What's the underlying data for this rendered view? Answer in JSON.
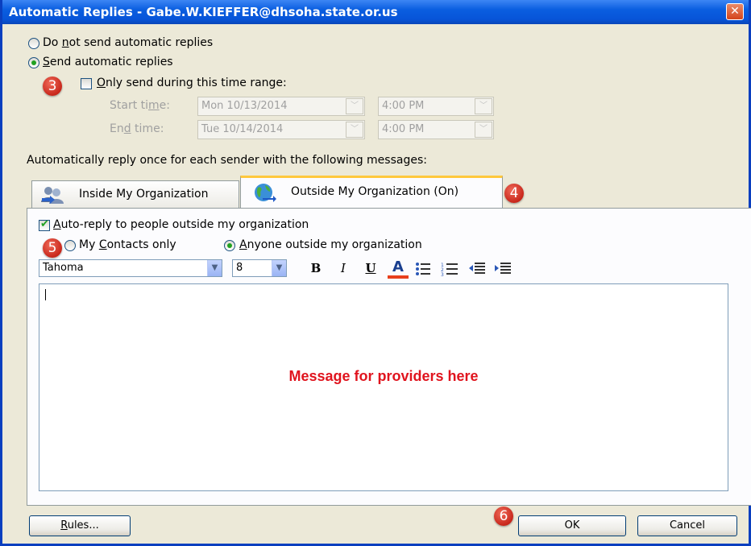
{
  "window": {
    "title": "Automatic Replies - Gabe.W.KIEFFER@dhsoha.state.or.us",
    "close_glyph": "✕"
  },
  "mode": {
    "do_not_send_prefix": "Do ",
    "do_not_send_u": "n",
    "do_not_send_rest": "ot send automatic replies",
    "send_u": "S",
    "send_rest": "end automatic replies",
    "selected": "send"
  },
  "time_range": {
    "only_send_u": "O",
    "only_send_rest": "nly send during this time range:",
    "checked": false,
    "start_label_pre": "Start ti",
    "start_label_u": "m",
    "start_label_post": "e:",
    "start_date": "Mon 10/13/2014",
    "start_time": "4:00 PM",
    "end_label_pre": "En",
    "end_label_u": "d",
    "end_label_post": " time:",
    "end_date": "Tue 10/14/2014",
    "end_time": "4:00 PM"
  },
  "reply_heading": "Automatically reply once for each sender with the following messages:",
  "tabs": [
    {
      "label": "Inside My Organization",
      "icon": "people-icon",
      "active": false
    },
    {
      "label": "Outside My Organization (On)",
      "icon": "globe-icon",
      "active": true
    }
  ],
  "outside": {
    "auto_reply_u": "A",
    "auto_reply_rest": "uto-reply to people outside my organization",
    "auto_reply_checked": true,
    "my_contacts_pre": "My ",
    "my_contacts_u": "C",
    "my_contacts_rest": "ontacts only",
    "anyone_u": "A",
    "anyone_rest": "nyone outside my organization",
    "audience_selected": "anyone"
  },
  "formatting": {
    "font": "Tahoma",
    "size": "8",
    "bold": "B",
    "italic": "I",
    "underline": "U",
    "font_color": "A",
    "font_color_value": "#e8401c"
  },
  "message": {
    "text": "Message for providers here",
    "color": "#e0141e"
  },
  "buttons": {
    "rules_u": "R",
    "rules_rest": "ules...",
    "ok": "OK",
    "cancel": "Cancel"
  },
  "callouts": [
    "3",
    "4",
    "5",
    "6"
  ]
}
